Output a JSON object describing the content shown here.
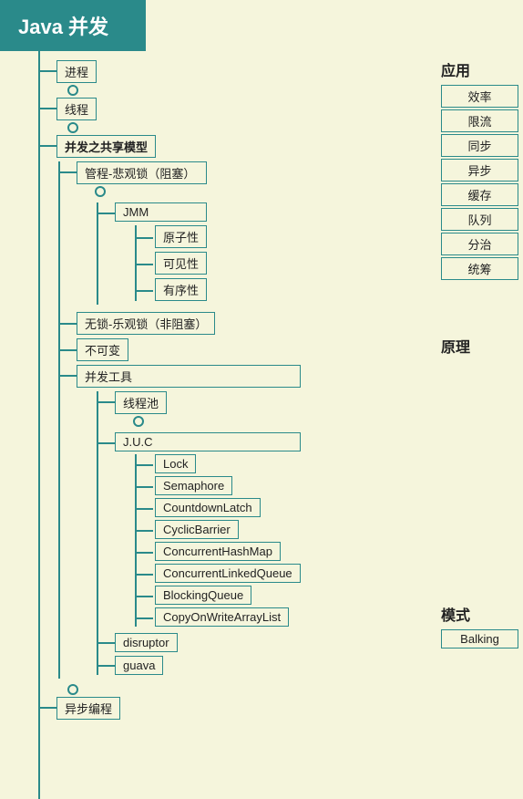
{
  "header": {
    "title": "Java 并发"
  },
  "right_panel": {
    "application": {
      "title": "应用",
      "items": [
        "效率",
        "限流",
        "同步",
        "异步",
        "缓存",
        "队列",
        "分治",
        "统筹"
      ]
    },
    "principle": {
      "title": "原理"
    },
    "pattern": {
      "title": "模式",
      "items": [
        "Balking"
      ]
    }
  },
  "tree": {
    "nodes": [
      {
        "id": "process",
        "label": "进程",
        "level": 0
      },
      {
        "id": "thread",
        "label": "线程",
        "level": 0
      },
      {
        "id": "shared-model",
        "label": "并发之共享模型",
        "level": 0,
        "bold": true,
        "children": [
          {
            "id": "pessimistic-lock",
            "label": "管程-悲观锁（阻塞）",
            "level": 1,
            "children": [
              {
                "id": "jmm",
                "label": "JMM",
                "level": 2,
                "children": [
                  {
                    "id": "atomicity",
                    "label": "原子性",
                    "level": 3
                  },
                  {
                    "id": "visibility",
                    "label": "可见性",
                    "level": 3
                  },
                  {
                    "id": "ordering",
                    "label": "有序性",
                    "level": 3
                  }
                ]
              }
            ]
          },
          {
            "id": "optimistic-lock",
            "label": "无锁-乐观锁（非阻塞）",
            "level": 1
          },
          {
            "id": "immutable",
            "label": "不可变",
            "level": 1
          },
          {
            "id": "concurrent-tools",
            "label": "并发工具",
            "level": 1,
            "children": [
              {
                "id": "thread-pool",
                "label": "线程池",
                "level": 2
              },
              {
                "id": "juc",
                "label": "J.U.C",
                "level": 2,
                "children": [
                  {
                    "id": "lock",
                    "label": "Lock",
                    "level": 3
                  },
                  {
                    "id": "semaphore",
                    "label": "Semaphore",
                    "level": 3
                  },
                  {
                    "id": "countdown-latch",
                    "label": "CountdownLatch",
                    "level": 3
                  },
                  {
                    "id": "cyclic-barrier",
                    "label": "CyclicBarrier",
                    "level": 3
                  },
                  {
                    "id": "concurrent-hashmap",
                    "label": "ConcurrentHashMap",
                    "level": 3
                  },
                  {
                    "id": "concurrent-linked-queue",
                    "label": "ConcurrentLinkedQueue",
                    "level": 3
                  },
                  {
                    "id": "blocking-queue",
                    "label": "BlockingQueue",
                    "level": 3
                  },
                  {
                    "id": "copy-on-write-array-list",
                    "label": "CopyOnWriteArrayList",
                    "level": 3
                  }
                ]
              },
              {
                "id": "disruptor",
                "label": "disruptor",
                "level": 2
              },
              {
                "id": "guava",
                "label": "guava",
                "level": 2
              }
            ]
          }
        ]
      },
      {
        "id": "async-programming",
        "label": "异步编程",
        "level": 0
      }
    ]
  }
}
